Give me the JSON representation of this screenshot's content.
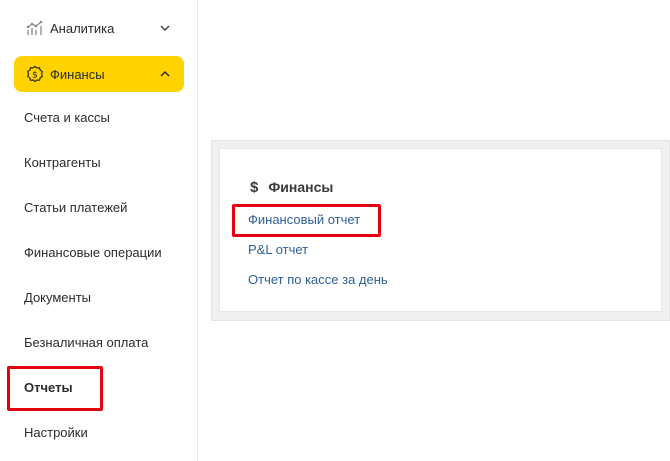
{
  "sidebar": {
    "analytics": {
      "label": "Аналитика",
      "icon": "analytics-chart-icon",
      "chevron": "chevron-down-icon"
    },
    "finance": {
      "label": "Финансы",
      "icon": "finance-coin-icon",
      "chevron": "chevron-up-icon",
      "background": "#ffd200"
    },
    "items": [
      {
        "label": "Счета и кассы"
      },
      {
        "label": "Контрагенты"
      },
      {
        "label": "Статьи платежей"
      },
      {
        "label": "Финансовые операции"
      },
      {
        "label": "Документы"
      },
      {
        "label": "Безналичная оплата"
      },
      {
        "label": "Отчеты",
        "active": true
      },
      {
        "label": "Настройки"
      }
    ]
  },
  "main": {
    "section": {
      "icon": "dollar-icon",
      "title": "Финансы",
      "links": [
        {
          "label": "Финансовый отчет"
        },
        {
          "label": "P&L отчет"
        },
        {
          "label": "Отчет по кассе за день"
        }
      ]
    }
  },
  "colors": {
    "accent": "#ffd200",
    "link": "#2d5f96",
    "highlight": "#e3000f"
  }
}
